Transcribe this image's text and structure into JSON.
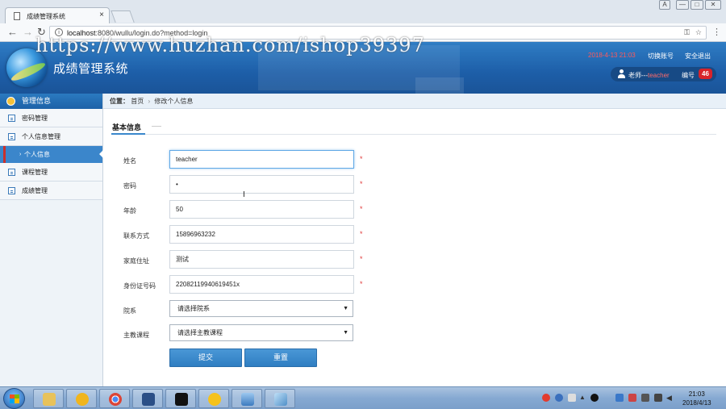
{
  "browser": {
    "tab_title": "成绩管理系统",
    "tab_close": "×",
    "url_host": "localhost",
    "url_rest": ":8080/wullu/login.do?method=login",
    "window_buttons": [
      "A",
      "—",
      "□",
      "✕"
    ]
  },
  "watermark": "https://www.huzhan.com/ishop39397",
  "header": {
    "app_title": "成绩管理系统",
    "datetime": "2018-4-13 21:03",
    "switch_account": "切换账号",
    "logout": "安全退出",
    "user_prefix": "老师---",
    "user_name": "teacher",
    "number_label": "编号",
    "number_value": "46"
  },
  "sidebar": {
    "title": "管理信息",
    "items": [
      {
        "label": "密码管理"
      },
      {
        "label": "个人信息管理"
      },
      {
        "label": "课程管理"
      },
      {
        "label": "成绩管理"
      }
    ],
    "active_sub": "个人信息"
  },
  "main": {
    "breadcrumb_label": "位置：",
    "breadcrumb_home": "首页",
    "breadcrumb_sep": "›",
    "breadcrumb_current": "修改个人信息",
    "section_title": "基本信息",
    "required_mark": "*",
    "fields": {
      "name": {
        "label": "姓名",
        "value": "teacher"
      },
      "password": {
        "label": "密码",
        "value": "•"
      },
      "age": {
        "label": "年龄",
        "value": "50"
      },
      "phone": {
        "label": "联系方式",
        "value": "15896963232"
      },
      "address": {
        "label": "家庭住址",
        "value": "测试"
      },
      "idcard": {
        "label": "身份证号码",
        "value": "22082119940619451x"
      },
      "department": {
        "label": "院系",
        "value": "请选择院系"
      },
      "course": {
        "label": "主教课程",
        "value": "请选择主教课程"
      }
    },
    "submit_label": "提交",
    "reset_label": "重置"
  },
  "taskbar": {
    "time": "21:03",
    "date": "2018/4/13"
  },
  "colors": {
    "header_blue": "#1d5ea8",
    "sidebar_active": "#3b86cb",
    "button_blue": "#3584c6",
    "required_red": "#e03b3b"
  }
}
